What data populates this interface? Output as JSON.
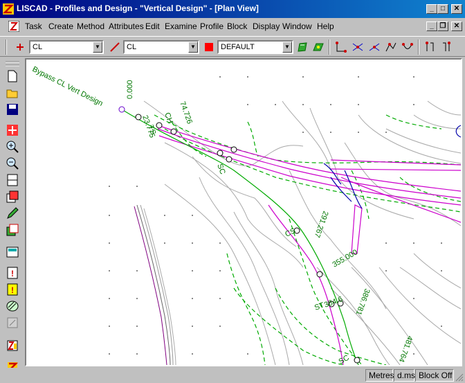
{
  "window": {
    "title": "LISCAD - Profiles and Design - \"Vertical Design\" - [Plan View]",
    "controls": {
      "minimize": "_",
      "maximize": "□",
      "close": "✕"
    },
    "doc_controls": {
      "minimize": "_",
      "restore": "❐",
      "close": "✕"
    }
  },
  "menu": [
    "Task",
    "Create",
    "Method",
    "Attributes",
    "Edit",
    "Examine",
    "Profile",
    "Block",
    "Display",
    "Window",
    "Help"
  ],
  "toolbar": {
    "combo1": "CL",
    "combo2": "CL",
    "combo3": "DEFAULT",
    "layer_color": "#ff0000"
  },
  "canvas": {
    "labels": {
      "bypass": "Bypass CL Vert Design",
      "ch0": "0.000",
      "ch23": "23.775",
      "ch74": "74.726",
      "ts": "TS",
      "ch": "CH",
      "sc": "SC",
      "ch291": "291.267",
      "cs": "CS",
      "ch355": "355.000",
      "ch386": "386.781",
      "ch384": "384.6",
      "ch481": "481.764",
      "st": "ST",
      "sc2": "SC"
    }
  },
  "status": {
    "units": "Metres",
    "angle": "d.ms",
    "block": "Block Off"
  },
  "colors": {
    "title_bar": "#000080",
    "road_line": "#cc00cc",
    "cl_line": "#00aa00",
    "contour": "#a0a0a0",
    "kerb": "#0000aa"
  }
}
